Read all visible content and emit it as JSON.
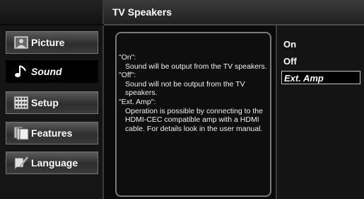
{
  "header": {
    "title": "TV Speakers"
  },
  "menu": {
    "items": [
      {
        "label": "Picture",
        "icon": "picture-icon",
        "active": false
      },
      {
        "label": "Sound",
        "icon": "music-note-icon",
        "active": true
      },
      {
        "label": "Setup",
        "icon": "grid-icon",
        "active": false
      },
      {
        "label": "Features",
        "icon": "features-icon",
        "active": false
      },
      {
        "label": "Language",
        "icon": "language-icon",
        "active": false
      }
    ]
  },
  "info": {
    "on_head": "\"On\":",
    "on_desc": "Sound will be output from the TV speakers.",
    "off_head": "\"Off\":",
    "off_desc": "Sound will not be output from the TV speakers.",
    "ext_head": "\"Ext. Amp\":",
    "ext_desc": "Operation is possible by connecting to the HDMI-CEC compatible amp with a HDMI cable. For details look in the user manual."
  },
  "options": {
    "items": [
      "On",
      "Off",
      "Ext. Amp"
    ],
    "selected": "Ext. Amp"
  }
}
